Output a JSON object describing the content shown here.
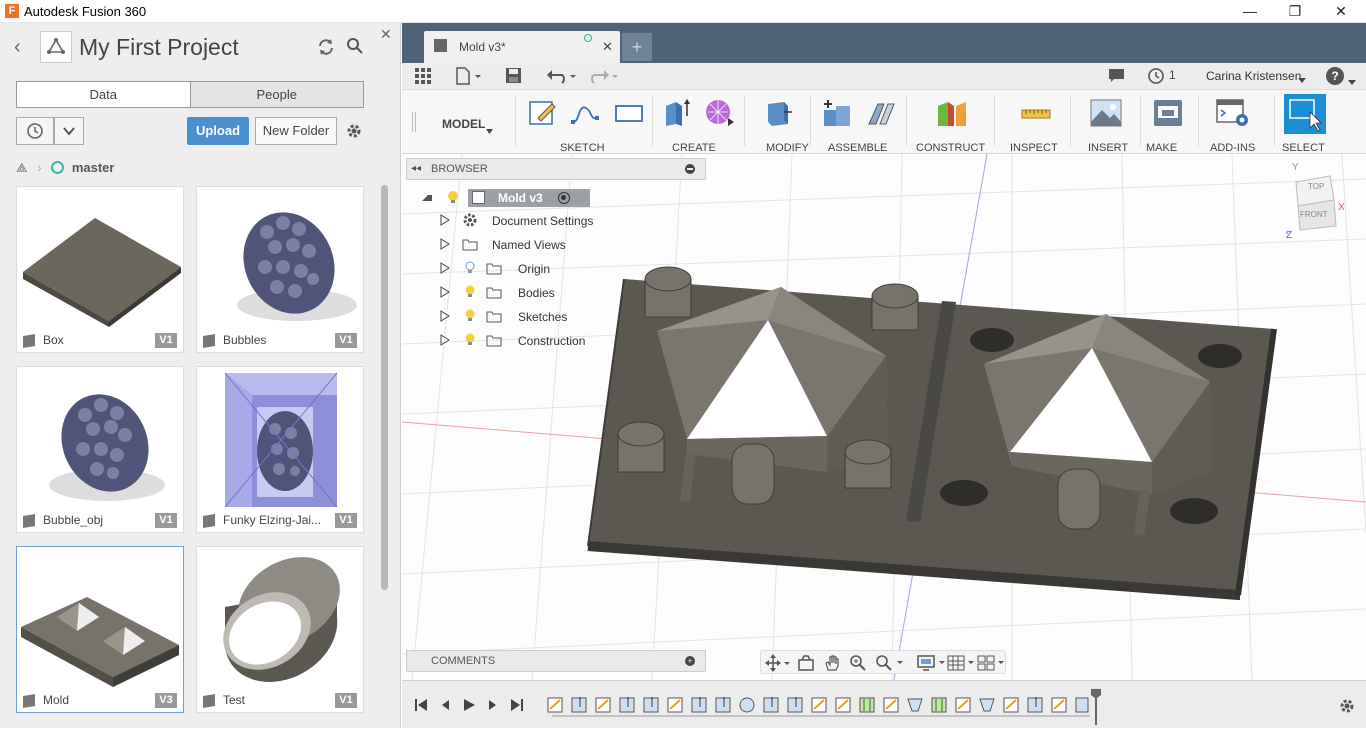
{
  "window": {
    "title": "Autodesk Fusion 360",
    "app_letter": "F",
    "minimize": "—",
    "maximize": "❐",
    "close": "✕"
  },
  "data_panel": {
    "project_title": "My First Project",
    "close_glyph": "✕",
    "tabs": [
      {
        "label": "Data"
      },
      {
        "label": "People"
      }
    ],
    "upload_label": "Upload",
    "new_folder_label": "New Folder",
    "branch": "master",
    "items": [
      {
        "name": "Box",
        "version": "V1"
      },
      {
        "name": "Bubbles",
        "version": "V1"
      },
      {
        "name": "Bubble_obj",
        "version": "V1"
      },
      {
        "name": "Funky Elzing-Jai...",
        "version": "V1"
      },
      {
        "name": "Mold",
        "version": "V3"
      },
      {
        "name": "Test",
        "version": "V1"
      }
    ]
  },
  "document_tab": {
    "label": "Mold v3*",
    "close": "✕",
    "new_tab": "+"
  },
  "topbar": {
    "jobs_count": "1",
    "user": "Carina Kristensen",
    "help": "?"
  },
  "toolbar": {
    "workspace": "MODEL",
    "groups": [
      "SKETCH",
      "CREATE",
      "MODIFY",
      "ASSEMBLE",
      "CONSTRUCT",
      "INSPECT",
      "INSERT",
      "MAKE",
      "ADD-INS",
      "SELECT"
    ]
  },
  "browser": {
    "title": "BROWSER",
    "root": "Mold v3",
    "nodes": [
      "Document Settings",
      "Named Views",
      "Origin",
      "Bodies",
      "Sketches",
      "Construction"
    ]
  },
  "viewcube": {
    "top": "TOP",
    "front": "FRONT",
    "x": "X",
    "y": "Y",
    "z": "Z"
  },
  "comments": {
    "title": "COMMENTS"
  },
  "colors": {
    "accent": "#4a8fd0",
    "tab_bar": "#4d6478",
    "select_active": "#1a8fd6"
  }
}
